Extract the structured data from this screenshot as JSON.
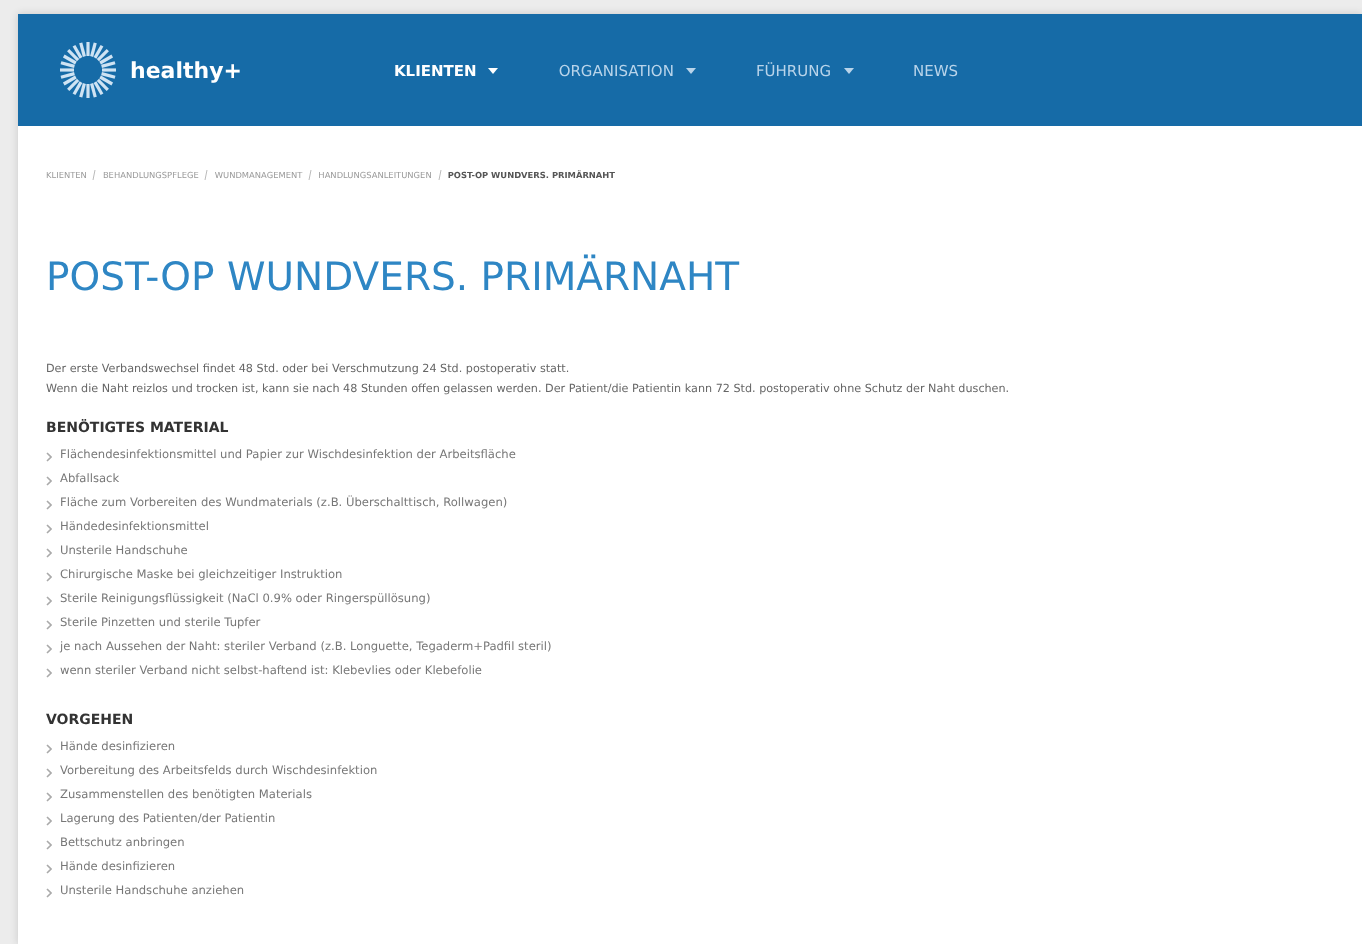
{
  "header": {
    "logo_text": "healthy+",
    "nav": [
      {
        "label": "KLIENTEN",
        "selected": true,
        "dropdown": true
      },
      {
        "label": "ORGANISATION",
        "selected": false,
        "dropdown": true
      },
      {
        "label": "FÜHRUNG",
        "selected": false,
        "dropdown": true
      },
      {
        "label": "NEWS",
        "selected": false,
        "dropdown": false
      }
    ]
  },
  "breadcrumb": [
    {
      "label": "KLIENTEN",
      "current": false
    },
    {
      "label": "BEHANDLUNGSPFLEGE",
      "current": false
    },
    {
      "label": "WUNDMANAGEMENT",
      "current": false
    },
    {
      "label": "HANDLUNGSANLEITUNGEN",
      "current": false
    },
    {
      "label": "POST-OP WUNDVERS. PRIMÄRNAHT",
      "current": true
    }
  ],
  "title": "POST-OP WUNDVERS. PRIMÄRNAHT",
  "intro": [
    "Der erste Verbandswechsel findet 48 Std. oder bei Verschmutzung 24 Std. postoperativ statt.",
    "Wenn die Naht reizlos und trocken ist, kann sie nach 48 Stunden offen gelassen werden. Der Patient/die Patientin kann 72 Std. postoperativ ohne Schutz der Naht duschen."
  ],
  "sections": [
    {
      "heading": "BENÖTIGTES MATERIAL",
      "items": [
        "Flächendesinfektionsmittel und Papier zur Wischdesinfektion der Arbeitsfläche",
        "Abfallsack",
        "Fläche zum Vorbereiten des Wundmaterials (z.B. Überschalttisch, Rollwagen)",
        "Händedesinfektionsmittel",
        "Unsterile Handschuhe",
        "Chirurgische Maske bei gleichzeitiger Instruktion",
        "Sterile Reinigungsflüssigkeit (NaCl 0.9% oder Ringerspüllösung)",
        "Sterile Pinzetten und sterile Tupfer",
        "je nach Aussehen der Naht: steriler Verband (z.B. Longuette, Tegaderm+Padfil steril)",
        "wenn steriler Verband nicht selbst-haftend ist: Klebevlies oder Klebefolie"
      ]
    },
    {
      "heading": "VORGEHEN",
      "items": [
        "Hände desinfizieren",
        "Vorbereitung des Arbeitsfelds durch Wischdesinfektion",
        "Zusammenstellen des benötigten Materials",
        "Lagerung des Patienten/der Patientin",
        "Bettschutz anbringen",
        "Hände desinfizieren",
        "Unsterile Handschuhe anziehen"
      ]
    }
  ]
}
